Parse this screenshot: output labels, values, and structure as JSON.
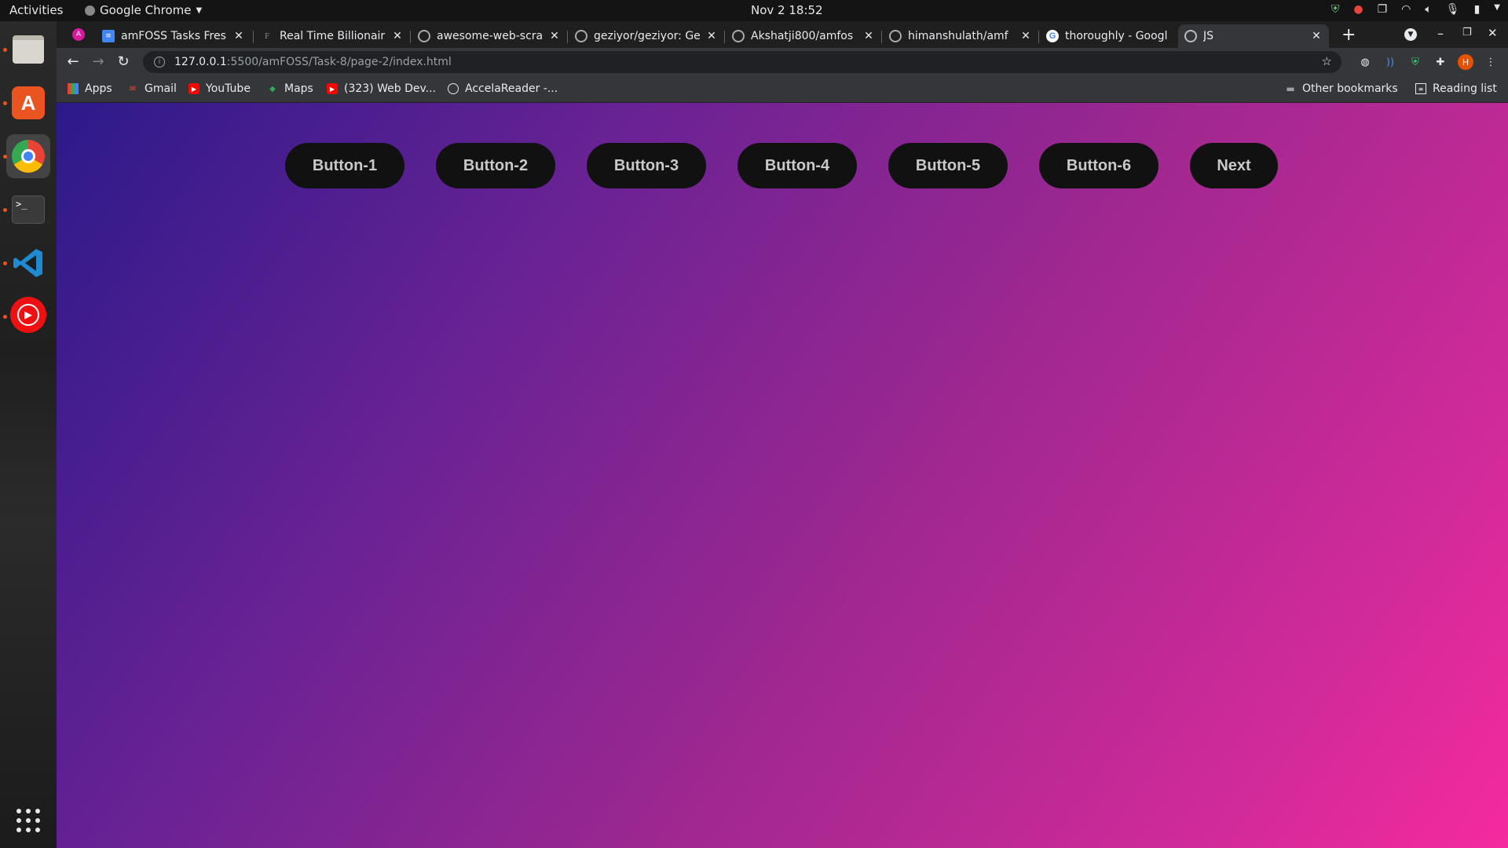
{
  "system": {
    "activities": "Activities",
    "app_name": "Google Chrome",
    "clock": "Nov 2  18:52"
  },
  "tabs": [
    {
      "title": "amFOSS Tasks Fres",
      "icon": "docs-icon"
    },
    {
      "title": "Real Time Billionair",
      "icon": "forbes-icon"
    },
    {
      "title": "awesome-web-scra",
      "icon": "github-icon"
    },
    {
      "title": "geziyor/geziyor: Ge",
      "icon": "github-icon"
    },
    {
      "title": "Akshatji800/amfos",
      "icon": "github-icon"
    },
    {
      "title": "himanshulath/amf",
      "icon": "github-icon"
    },
    {
      "title": "thoroughly - Googl",
      "icon": "google-icon"
    },
    {
      "title": "JS",
      "icon": "globe-icon",
      "active": true
    }
  ],
  "address": {
    "host": "127.0.0.1",
    "rest": ":5500/amFOSS/Task-8/page-2/index.html"
  },
  "bookmarks": {
    "apps": "Apps",
    "items": [
      "Gmail",
      "YouTube",
      "Maps",
      "(323) Web Dev...",
      "AccelaReader -..."
    ],
    "other": "Other bookmarks",
    "reading_list": "Reading list"
  },
  "profile_initial": "H",
  "page": {
    "buttons": [
      "Button-1",
      "Button-2",
      "Button-3",
      "Button-4",
      "Button-5",
      "Button-6"
    ],
    "next": "Next"
  },
  "colors": {
    "gradient_start": "#2c1a8a",
    "gradient_end": "#f52a9e",
    "button_bg": "#111111",
    "button_text": "#c9c9c9"
  }
}
